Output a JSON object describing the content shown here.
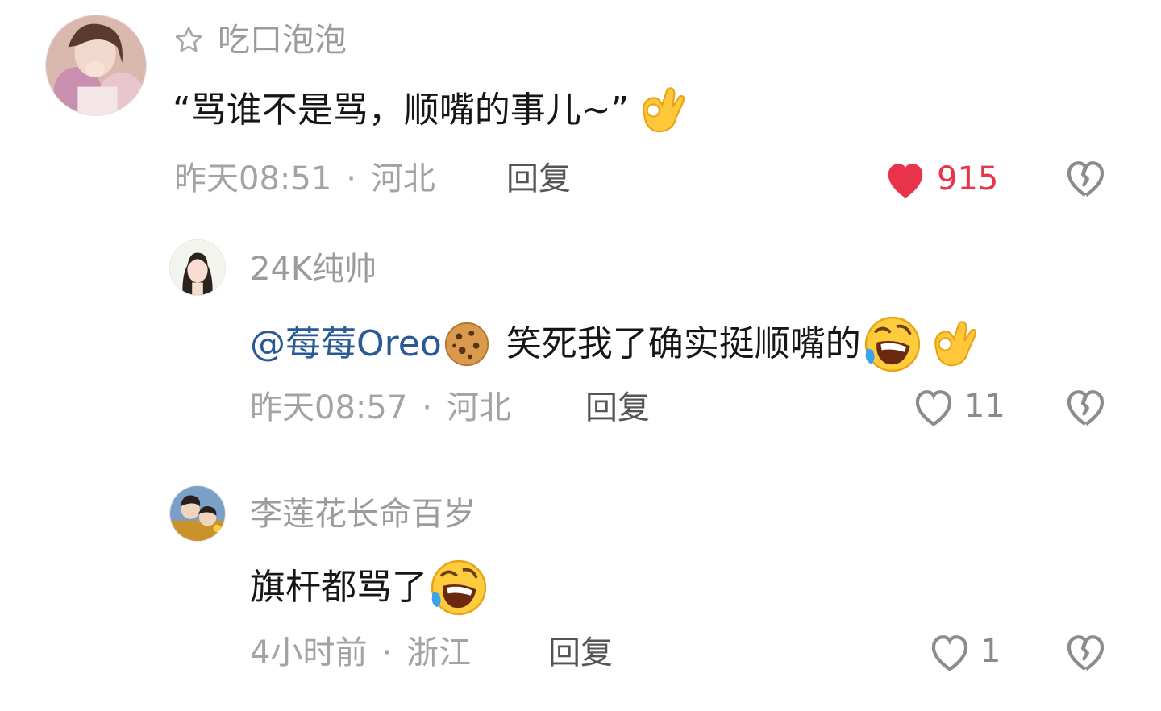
{
  "comments": [
    {
      "username": "吃口泡泡",
      "text": "“骂谁不是骂，顺嘴的事儿~”",
      "time": "昨天08:51",
      "location": "河北",
      "reply_label": "回复",
      "likes": "915",
      "liked": true
    },
    {
      "username": "24K纯帅",
      "mention": "@莓莓Oreo",
      "text": "笑死我了确实挺顺嘴的",
      "time": "昨天08:57",
      "location": "河北",
      "reply_label": "回复",
      "likes": "11",
      "liked": false
    },
    {
      "username": "李莲花长命百岁",
      "text": "旗杆都骂了",
      "time": "4小时前",
      "location": "浙江",
      "reply_label": "回复",
      "likes": "1",
      "liked": false
    }
  ],
  "separator": "·",
  "colors": {
    "liked": "#e8334a",
    "mention": "#2a5a95",
    "meta": "#a3a3a3",
    "text": "#161616"
  },
  "icons": {
    "badge": "star-outline-icon",
    "like": "heart-icon",
    "dislike": "broken-heart-icon",
    "ok": "ok-hand-emoji",
    "laugh": "rolling-laughing-emoji",
    "cookie": "cookie-emoji"
  }
}
